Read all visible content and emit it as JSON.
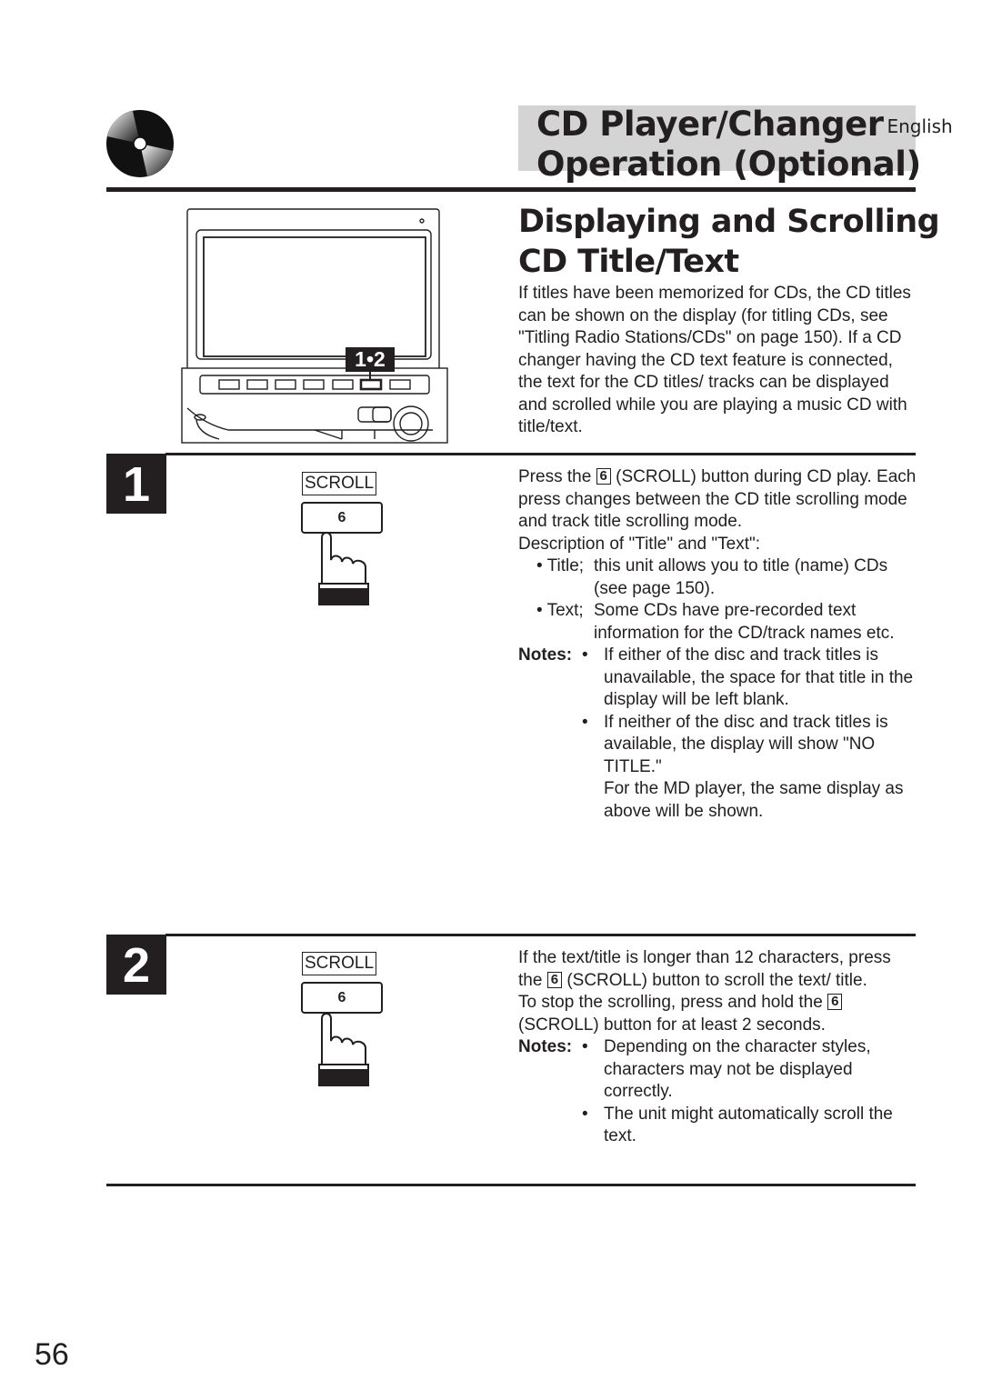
{
  "header": {
    "icon": "cd-disc-icon",
    "title_line1": "CD Player/Changer",
    "language": "English",
    "title_line2": "Operation (Optional)"
  },
  "illustration": {
    "name": "head-unit-front-panel",
    "callout": "1•2"
  },
  "section": {
    "title_line1": "Displaying and Scrolling",
    "title_line2": "CD Title/Text",
    "intro": "If titles have been memorized for CDs, the CD titles can be shown on the display (for titling CDs, see \"Titling Radio Stations/CDs\" on page 150). If a CD changer having the CD text feature is connected, the text for the CD titles/ tracks can be displayed and scrolled while you are playing a music CD with title/text."
  },
  "steps": [
    {
      "number": "1",
      "button_label": "SCROLL",
      "key_label": "6",
      "text_a_pre": "Press the",
      "key_inline": "6",
      "text_a_post": "(SCROLL) button during CD play. Each press changes between the CD title scrolling mode and track title scrolling mode.",
      "desc_heading": "Description of \"Title\" and \"Text\":",
      "descriptions": [
        {
          "key": "• Title;",
          "text": "this unit allows you to title (name) CDs (see page 150)."
        },
        {
          "key": "• Text;",
          "text": "Some CDs have pre-recorded text information for the CD/track names etc."
        }
      ],
      "notes_label": "Notes:",
      "notes": [
        "If either of the disc and track titles is unavailable, the space for that title in the display will be left blank.",
        "If neither of the disc and track titles is available, the display will show \"NO TITLE.\""
      ],
      "notes_extra": "For the MD player, the same display as above will be shown."
    },
    {
      "number": "2",
      "button_label": "SCROLL",
      "key_label": "6",
      "text_a_pre": "If the text/title is longer than 12 characters, press the",
      "key_inline": "6",
      "text_a_post": "(SCROLL) button to scroll the text/ title.",
      "text_b_pre": "To stop the scrolling, press and hold the",
      "key_inline_b": "6",
      "text_b_post": "(SCROLL) button for at least 2 seconds.",
      "notes_label": "Notes:",
      "notes": [
        "Depending on the character styles, characters may not be displayed correctly.",
        "The unit might automatically scroll the text."
      ]
    }
  ],
  "footer": {
    "page_number": "56"
  }
}
